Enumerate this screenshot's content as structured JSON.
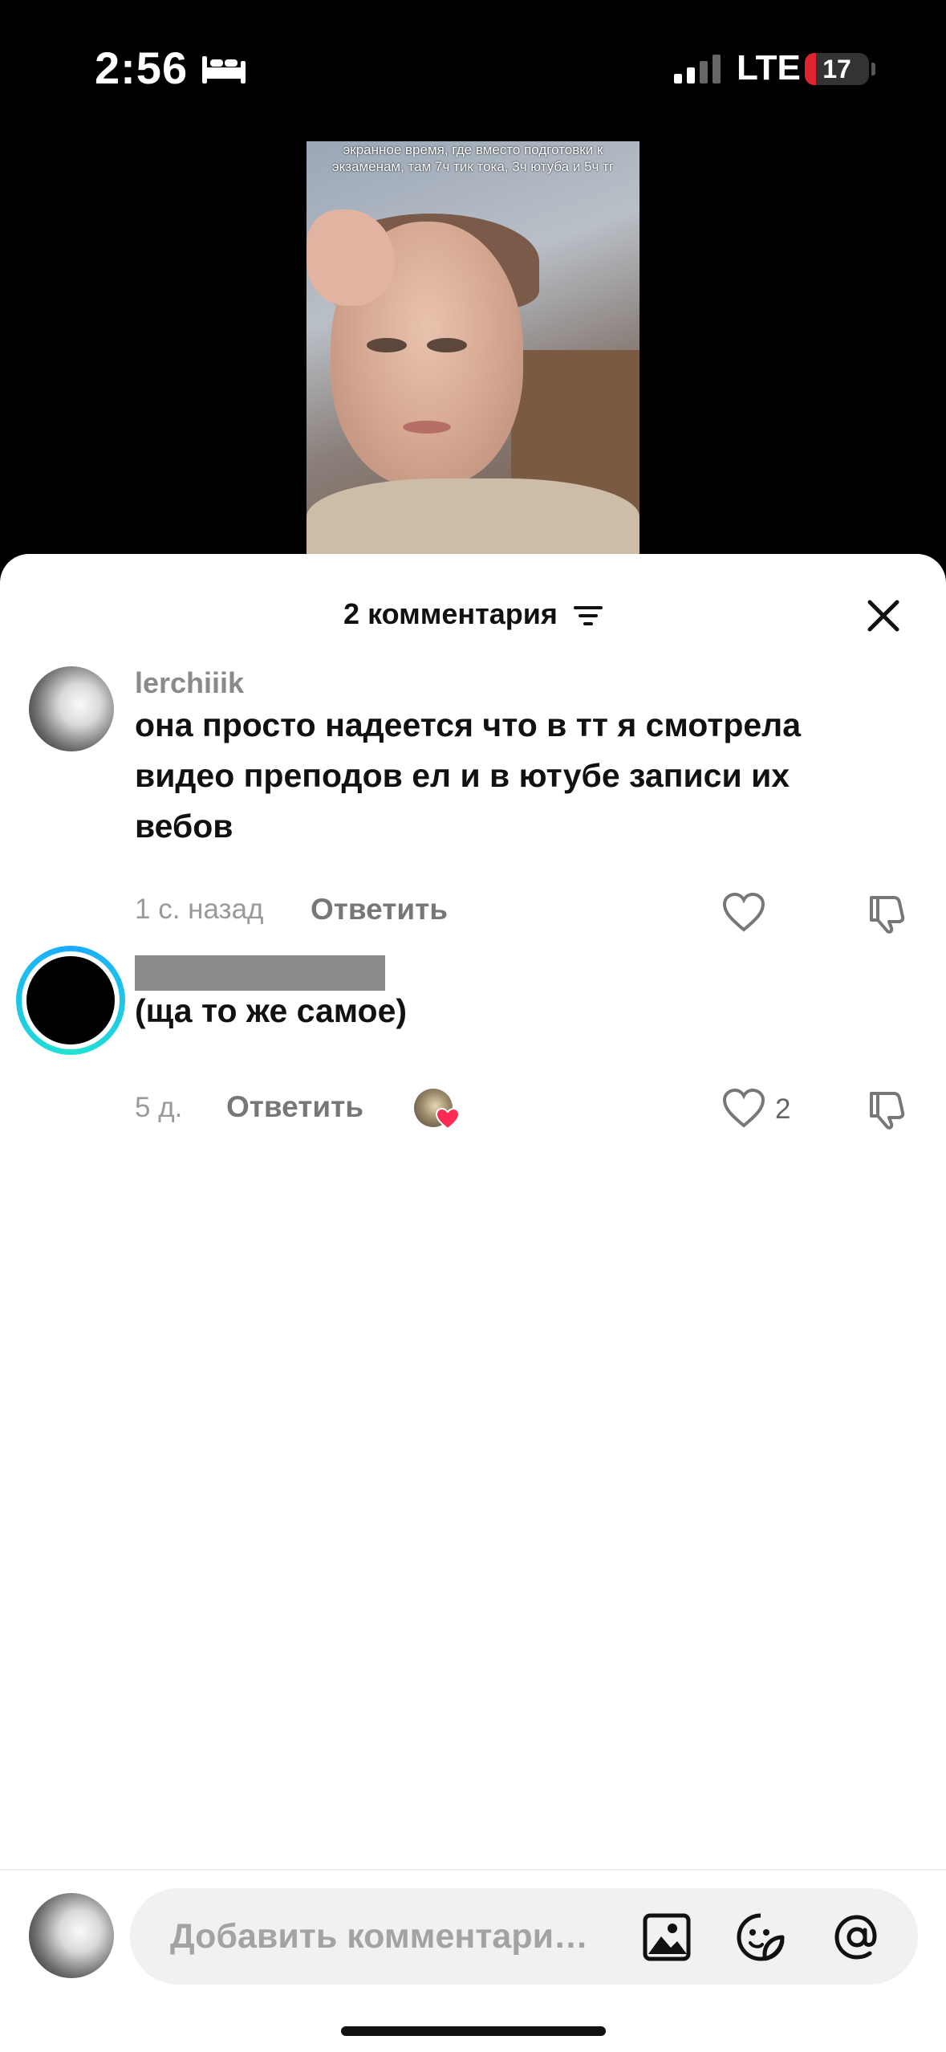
{
  "status_bar": {
    "time": "2:56",
    "network": "LTE",
    "battery_level": "17",
    "battery_fraction": 0.17,
    "icons": [
      "bed-icon",
      "signal-icon"
    ]
  },
  "video": {
    "caption": "экранное время, где вместо подготовки к экзаменам, там 7ч тик тока, 3ч ютуба и 5ч тг"
  },
  "sheet": {
    "title": "2 комментария",
    "icons": [
      "sort-icon",
      "close-icon"
    ]
  },
  "comments": [
    {
      "username": "lerchiiik",
      "text_lines": [
        "она просто надеется что в тт я смотрела",
        "видео преподов ел и в ютубе записи их",
        "вебов"
      ],
      "time": "1 с. назад",
      "reply_label": "Ответить",
      "likes": ""
    },
    {
      "username": "",
      "text_lines": [
        "(ща то же самое)"
      ],
      "time": "5 д.",
      "reply_label": "Ответить",
      "likes": "2"
    }
  ],
  "input": {
    "placeholder": "Добавить комментари…",
    "icons": [
      "image-icon",
      "sticker-icon",
      "mention-icon"
    ]
  },
  "colors": {
    "accent_red": "#fe2c55",
    "battery_red": "#e0242f",
    "ring_blue": "#1aa9ff",
    "ring_teal": "#22e3d0"
  }
}
